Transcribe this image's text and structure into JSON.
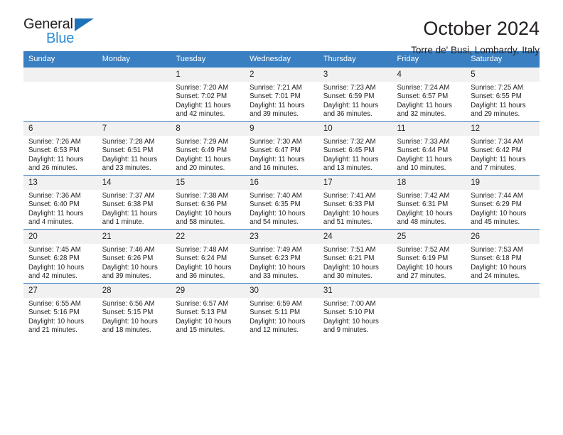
{
  "brand": {
    "name_top": "General",
    "name_bottom": "Blue",
    "triangle_color": "#1c71b8",
    "blue_color": "#2a8bd5"
  },
  "header": {
    "title": "October 2024",
    "subtitle": "Torre de' Busi, Lombardy, Italy"
  },
  "theme": {
    "header_blue": "#3a7fc1",
    "daynum_bg": "#f1f1f1",
    "text": "#231f20"
  },
  "weekday_headers": [
    "Sunday",
    "Monday",
    "Tuesday",
    "Wednesday",
    "Thursday",
    "Friday",
    "Saturday"
  ],
  "labels": {
    "sunrise_prefix": "Sunrise: ",
    "sunset_prefix": "Sunset: ",
    "daylight_prefix": "Daylight: "
  },
  "weeks": [
    [
      {
        "day": "",
        "sunrise": "",
        "sunset": "",
        "daylight": ""
      },
      {
        "day": "",
        "sunrise": "",
        "sunset": "",
        "daylight": ""
      },
      {
        "day": "1",
        "sunrise": "Sunrise: 7:20 AM",
        "sunset": "Sunset: 7:02 PM",
        "daylight": "Daylight: 11 hours and 42 minutes."
      },
      {
        "day": "2",
        "sunrise": "Sunrise: 7:21 AM",
        "sunset": "Sunset: 7:01 PM",
        "daylight": "Daylight: 11 hours and 39 minutes."
      },
      {
        "day": "3",
        "sunrise": "Sunrise: 7:23 AM",
        "sunset": "Sunset: 6:59 PM",
        "daylight": "Daylight: 11 hours and 36 minutes."
      },
      {
        "day": "4",
        "sunrise": "Sunrise: 7:24 AM",
        "sunset": "Sunset: 6:57 PM",
        "daylight": "Daylight: 11 hours and 32 minutes."
      },
      {
        "day": "5",
        "sunrise": "Sunrise: 7:25 AM",
        "sunset": "Sunset: 6:55 PM",
        "daylight": "Daylight: 11 hours and 29 minutes."
      }
    ],
    [
      {
        "day": "6",
        "sunrise": "Sunrise: 7:26 AM",
        "sunset": "Sunset: 6:53 PM",
        "daylight": "Daylight: 11 hours and 26 minutes."
      },
      {
        "day": "7",
        "sunrise": "Sunrise: 7:28 AM",
        "sunset": "Sunset: 6:51 PM",
        "daylight": "Daylight: 11 hours and 23 minutes."
      },
      {
        "day": "8",
        "sunrise": "Sunrise: 7:29 AM",
        "sunset": "Sunset: 6:49 PM",
        "daylight": "Daylight: 11 hours and 20 minutes."
      },
      {
        "day": "9",
        "sunrise": "Sunrise: 7:30 AM",
        "sunset": "Sunset: 6:47 PM",
        "daylight": "Daylight: 11 hours and 16 minutes."
      },
      {
        "day": "10",
        "sunrise": "Sunrise: 7:32 AM",
        "sunset": "Sunset: 6:45 PM",
        "daylight": "Daylight: 11 hours and 13 minutes."
      },
      {
        "day": "11",
        "sunrise": "Sunrise: 7:33 AM",
        "sunset": "Sunset: 6:44 PM",
        "daylight": "Daylight: 11 hours and 10 minutes."
      },
      {
        "day": "12",
        "sunrise": "Sunrise: 7:34 AM",
        "sunset": "Sunset: 6:42 PM",
        "daylight": "Daylight: 11 hours and 7 minutes."
      }
    ],
    [
      {
        "day": "13",
        "sunrise": "Sunrise: 7:36 AM",
        "sunset": "Sunset: 6:40 PM",
        "daylight": "Daylight: 11 hours and 4 minutes."
      },
      {
        "day": "14",
        "sunrise": "Sunrise: 7:37 AM",
        "sunset": "Sunset: 6:38 PM",
        "daylight": "Daylight: 11 hours and 1 minute."
      },
      {
        "day": "15",
        "sunrise": "Sunrise: 7:38 AM",
        "sunset": "Sunset: 6:36 PM",
        "daylight": "Daylight: 10 hours and 58 minutes."
      },
      {
        "day": "16",
        "sunrise": "Sunrise: 7:40 AM",
        "sunset": "Sunset: 6:35 PM",
        "daylight": "Daylight: 10 hours and 54 minutes."
      },
      {
        "day": "17",
        "sunrise": "Sunrise: 7:41 AM",
        "sunset": "Sunset: 6:33 PM",
        "daylight": "Daylight: 10 hours and 51 minutes."
      },
      {
        "day": "18",
        "sunrise": "Sunrise: 7:42 AM",
        "sunset": "Sunset: 6:31 PM",
        "daylight": "Daylight: 10 hours and 48 minutes."
      },
      {
        "day": "19",
        "sunrise": "Sunrise: 7:44 AM",
        "sunset": "Sunset: 6:29 PM",
        "daylight": "Daylight: 10 hours and 45 minutes."
      }
    ],
    [
      {
        "day": "20",
        "sunrise": "Sunrise: 7:45 AM",
        "sunset": "Sunset: 6:28 PM",
        "daylight": "Daylight: 10 hours and 42 minutes."
      },
      {
        "day": "21",
        "sunrise": "Sunrise: 7:46 AM",
        "sunset": "Sunset: 6:26 PM",
        "daylight": "Daylight: 10 hours and 39 minutes."
      },
      {
        "day": "22",
        "sunrise": "Sunrise: 7:48 AM",
        "sunset": "Sunset: 6:24 PM",
        "daylight": "Daylight: 10 hours and 36 minutes."
      },
      {
        "day": "23",
        "sunrise": "Sunrise: 7:49 AM",
        "sunset": "Sunset: 6:23 PM",
        "daylight": "Daylight: 10 hours and 33 minutes."
      },
      {
        "day": "24",
        "sunrise": "Sunrise: 7:51 AM",
        "sunset": "Sunset: 6:21 PM",
        "daylight": "Daylight: 10 hours and 30 minutes."
      },
      {
        "day": "25",
        "sunrise": "Sunrise: 7:52 AM",
        "sunset": "Sunset: 6:19 PM",
        "daylight": "Daylight: 10 hours and 27 minutes."
      },
      {
        "day": "26",
        "sunrise": "Sunrise: 7:53 AM",
        "sunset": "Sunset: 6:18 PM",
        "daylight": "Daylight: 10 hours and 24 minutes."
      }
    ],
    [
      {
        "day": "27",
        "sunrise": "Sunrise: 6:55 AM",
        "sunset": "Sunset: 5:16 PM",
        "daylight": "Daylight: 10 hours and 21 minutes."
      },
      {
        "day": "28",
        "sunrise": "Sunrise: 6:56 AM",
        "sunset": "Sunset: 5:15 PM",
        "daylight": "Daylight: 10 hours and 18 minutes."
      },
      {
        "day": "29",
        "sunrise": "Sunrise: 6:57 AM",
        "sunset": "Sunset: 5:13 PM",
        "daylight": "Daylight: 10 hours and 15 minutes."
      },
      {
        "day": "30",
        "sunrise": "Sunrise: 6:59 AM",
        "sunset": "Sunset: 5:11 PM",
        "daylight": "Daylight: 10 hours and 12 minutes."
      },
      {
        "day": "31",
        "sunrise": "Sunrise: 7:00 AM",
        "sunset": "Sunset: 5:10 PM",
        "daylight": "Daylight: 10 hours and 9 minutes."
      },
      {
        "day": "",
        "sunrise": "",
        "sunset": "",
        "daylight": ""
      },
      {
        "day": "",
        "sunrise": "",
        "sunset": "",
        "daylight": ""
      }
    ]
  ]
}
